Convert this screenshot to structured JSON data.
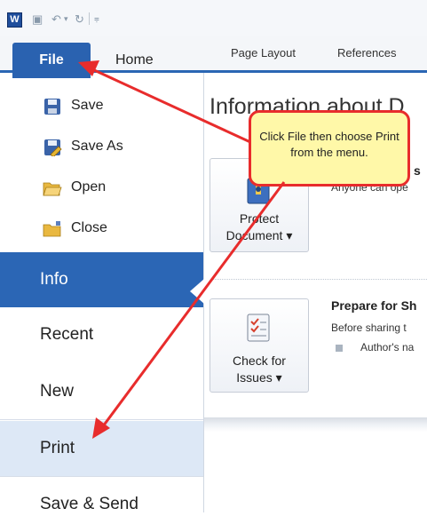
{
  "quick_access": {
    "word_icon_letter": "W"
  },
  "ribbon": {
    "file_tab": "File",
    "home_tab": "Home",
    "tabs": [
      "Page Layout",
      "References"
    ]
  },
  "backstage": {
    "commands": [
      {
        "label": "Save",
        "icon": "save-icon"
      },
      {
        "label": "Save As",
        "icon": "save-as-icon"
      },
      {
        "label": "Open",
        "icon": "open-folder-icon"
      },
      {
        "label": "Close",
        "icon": "close-folder-icon"
      }
    ],
    "sections": [
      "Info",
      "Recent",
      "New",
      "Print",
      "Save & Send"
    ],
    "selected": "Info",
    "highlighted": "Print"
  },
  "content": {
    "heading": "Information about D",
    "protect": {
      "button_line1": "Protect",
      "button_line2": "Document ▾",
      "partial_title": "s",
      "partial_text": "Anyone can ope"
    },
    "prepare": {
      "title": "Prepare for Sh",
      "text": "Before sharing t",
      "bullet": "Author's na",
      "button_line1": "Check for",
      "button_line2": "Issues ▾"
    }
  },
  "callout": {
    "text": "Click File then choose Print from the menu."
  },
  "colors": {
    "accent_blue": "#2b66b5",
    "arrow_red": "#e82c2c",
    "callout_fill": "#fff8a8"
  }
}
